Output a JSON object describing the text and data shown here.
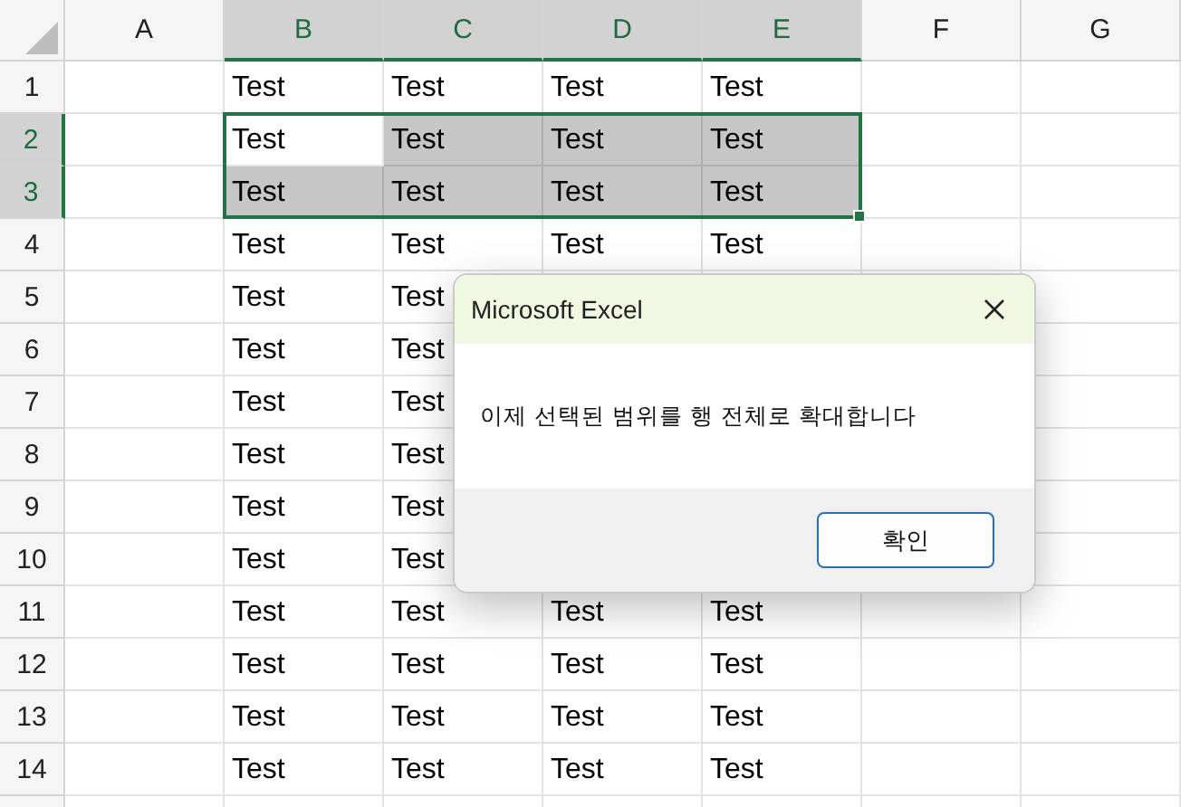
{
  "sheet": {
    "columns": [
      {
        "label": "A",
        "selected": false
      },
      {
        "label": "B",
        "selected": true
      },
      {
        "label": "C",
        "selected": true
      },
      {
        "label": "D",
        "selected": true
      },
      {
        "label": "E",
        "selected": true
      },
      {
        "label": "F",
        "selected": false
      },
      {
        "label": "G",
        "selected": false
      }
    ],
    "rows": [
      {
        "label": "1",
        "selected": false,
        "cells": [
          {
            "selected": false
          },
          {
            "text": "Test",
            "selected": false
          },
          {
            "text": "Test",
            "selected": false
          },
          {
            "text": "Test",
            "selected": false
          },
          {
            "text": "Test",
            "selected": false
          },
          {
            "selected": false
          },
          {
            "selected": false
          }
        ]
      },
      {
        "label": "2",
        "selected": true,
        "cells": [
          {
            "selected": false
          },
          {
            "text": "Test",
            "selected": true,
            "active": true
          },
          {
            "text": "Test",
            "selected": true
          },
          {
            "text": "Test",
            "selected": true
          },
          {
            "text": "Test",
            "selected": true
          },
          {
            "selected": false
          },
          {
            "selected": false
          }
        ]
      },
      {
        "label": "3",
        "selected": true,
        "cells": [
          {
            "selected": false
          },
          {
            "text": "Test",
            "selected": true
          },
          {
            "text": "Test",
            "selected": true
          },
          {
            "text": "Test",
            "selected": true
          },
          {
            "text": "Test",
            "selected": true
          },
          {
            "selected": false
          },
          {
            "selected": false
          }
        ]
      },
      {
        "label": "4",
        "selected": false,
        "cells": [
          {
            "selected": false
          },
          {
            "text": "Test",
            "selected": false
          },
          {
            "text": "Test",
            "selected": false
          },
          {
            "text": "Test",
            "selected": false
          },
          {
            "text": "Test",
            "selected": false
          },
          {
            "selected": false
          },
          {
            "selected": false
          }
        ]
      },
      {
        "label": "5",
        "selected": false,
        "cells": [
          {
            "selected": false
          },
          {
            "text": "Test",
            "selected": false
          },
          {
            "text": "Test",
            "selected": false
          },
          {
            "selected": false
          },
          {
            "selected": false
          },
          {
            "selected": false
          },
          {
            "selected": false
          }
        ]
      },
      {
        "label": "6",
        "selected": false,
        "cells": [
          {
            "selected": false
          },
          {
            "text": "Test",
            "selected": false
          },
          {
            "text": "Test",
            "selected": false
          },
          null,
          null,
          null,
          {
            "selected": false
          }
        ]
      },
      {
        "label": "7",
        "selected": false,
        "cells": [
          {
            "selected": false
          },
          {
            "text": "Test",
            "selected": false
          },
          {
            "text": "Test",
            "selected": false
          },
          null,
          null,
          null,
          {
            "selected": false
          }
        ]
      },
      {
        "label": "8",
        "selected": false,
        "cells": [
          {
            "selected": false
          },
          {
            "text": "Test",
            "selected": false
          },
          {
            "text": "Test",
            "selected": false
          },
          null,
          null,
          null,
          {
            "selected": false
          }
        ]
      },
      {
        "label": "9",
        "selected": false,
        "cells": [
          {
            "selected": false
          },
          {
            "text": "Test",
            "selected": false
          },
          {
            "text": "Test",
            "selected": false
          },
          null,
          null,
          null,
          {
            "selected": false
          }
        ]
      },
      {
        "label": "10",
        "selected": false,
        "cells": [
          {
            "selected": false
          },
          {
            "text": "Test",
            "selected": false
          },
          {
            "text": "Test",
            "selected": false
          },
          null,
          null,
          null,
          {
            "selected": false
          }
        ]
      },
      {
        "label": "11",
        "selected": false,
        "cells": [
          {
            "selected": false
          },
          {
            "text": "Test",
            "selected": false
          },
          {
            "text": "Test",
            "selected": false
          },
          {
            "text": "Test",
            "selected": false
          },
          {
            "text": "Test",
            "selected": false
          },
          {
            "selected": false
          },
          {
            "selected": false
          }
        ]
      },
      {
        "label": "12",
        "selected": false,
        "cells": [
          {
            "selected": false
          },
          {
            "text": "Test",
            "selected": false
          },
          {
            "text": "Test",
            "selected": false
          },
          {
            "text": "Test",
            "selected": false
          },
          {
            "text": "Test",
            "selected": false
          },
          {
            "selected": false
          },
          {
            "selected": false
          }
        ]
      },
      {
        "label": "13",
        "selected": false,
        "cells": [
          {
            "selected": false
          },
          {
            "text": "Test",
            "selected": false
          },
          {
            "text": "Test",
            "selected": false
          },
          {
            "text": "Test",
            "selected": false
          },
          {
            "text": "Test",
            "selected": false
          },
          {
            "selected": false
          },
          {
            "selected": false
          }
        ]
      },
      {
        "label": "14",
        "selected": false,
        "cells": [
          {
            "selected": false
          },
          {
            "text": "Test",
            "selected": false
          },
          {
            "text": "Test",
            "selected": false
          },
          {
            "text": "Test",
            "selected": false
          },
          {
            "text": "Test",
            "selected": false
          },
          {
            "selected": false
          },
          {
            "selected": false
          }
        ]
      }
    ]
  },
  "dialog": {
    "title": "Microsoft Excel",
    "message": "이제 선택된 범위를 행 전체로 확대합니다",
    "buttons": [
      {
        "label": "확인",
        "default": true
      }
    ]
  }
}
